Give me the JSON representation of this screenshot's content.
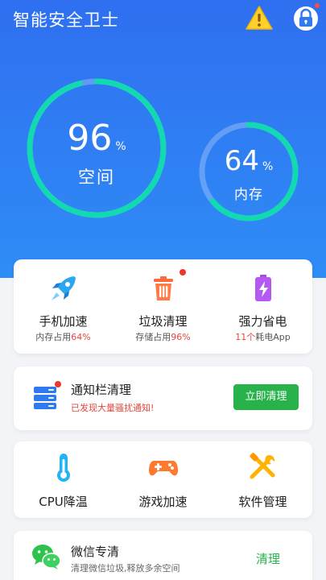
{
  "header": {
    "title": "智能安全卫士",
    "icons": [
      "warning-icon",
      "lock-icon"
    ]
  },
  "rings": {
    "space": {
      "value": "96",
      "unit": "%",
      "label": "空间",
      "fraction": 0.96
    },
    "memory": {
      "value": "64",
      "unit": "%",
      "label": "内存",
      "fraction": 0.64
    }
  },
  "features": [
    {
      "label": "手机加速",
      "sub_prefix": "内存占用",
      "sub_value": "64%",
      "icon": "rocket-icon"
    },
    {
      "label": "垃圾清理",
      "sub_prefix": "存储占用",
      "sub_value": "96%",
      "icon": "trash-icon"
    },
    {
      "label": "强力省电",
      "sub_prefix": "",
      "sub_value": "11个",
      "sub_suffix": "耗电App",
      "icon": "battery-icon"
    }
  ],
  "notification": {
    "title": "通知栏清理",
    "subtitle": "已发现大量骚扰通知!",
    "button": "立即清理"
  },
  "tools": [
    {
      "label": "CPU降温",
      "icon": "thermometer-icon"
    },
    {
      "label": "游戏加速",
      "icon": "gamepad-icon"
    },
    {
      "label": "软件管理",
      "icon": "tools-icon"
    }
  ],
  "wechat": {
    "title": "微信专清",
    "subtitle": "清理微信垃圾,释放多余空间",
    "button": "清理"
  },
  "colors": {
    "hero_top": "#2f6ff0",
    "hero_bottom": "#2f8cf6",
    "ring_progress": "#13d9b0",
    "accent_red": "#e4473d",
    "accent_green": "#27b24a"
  }
}
